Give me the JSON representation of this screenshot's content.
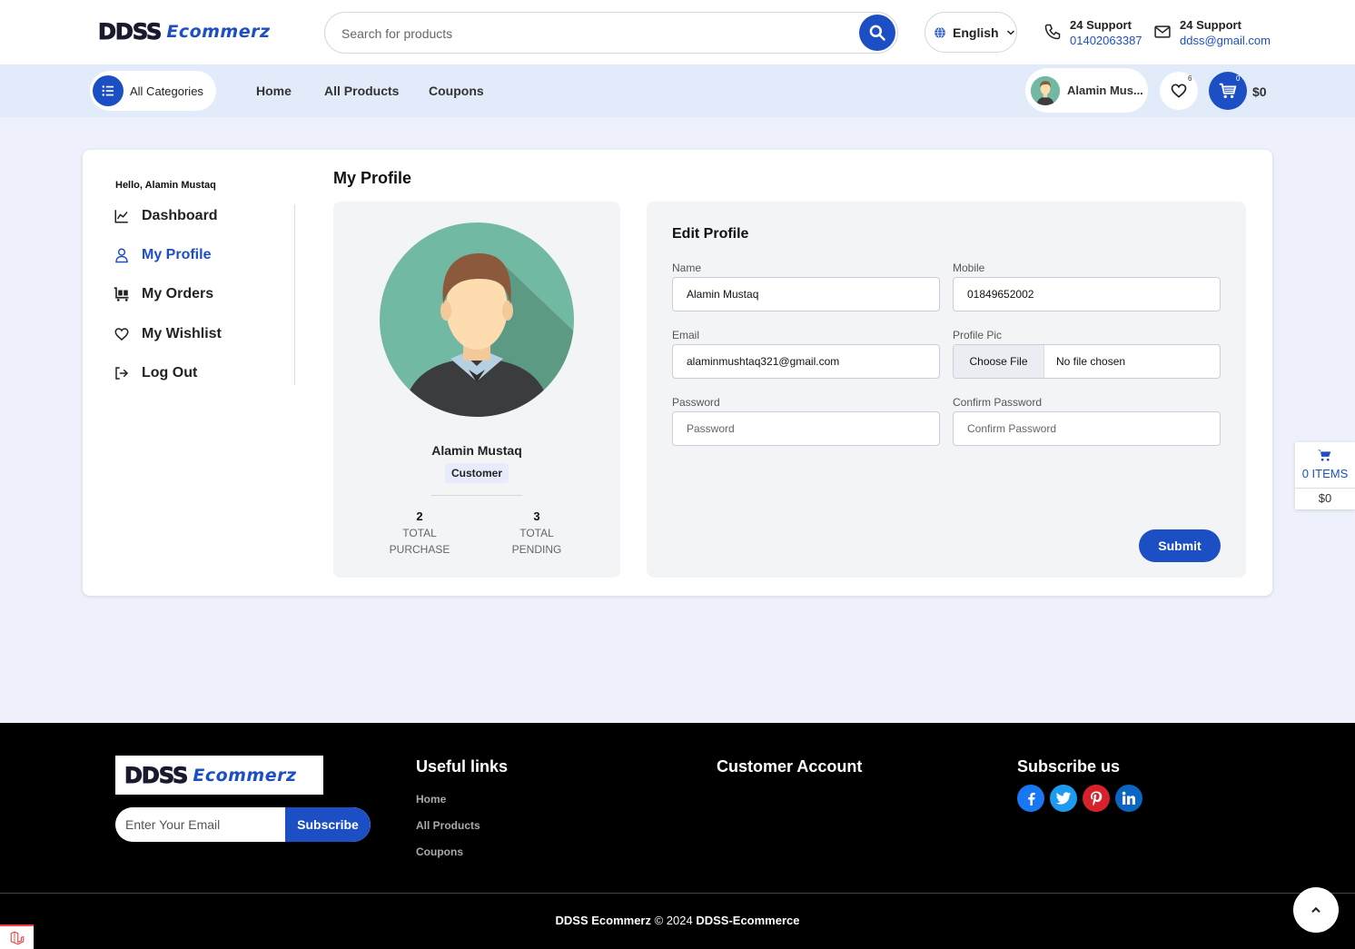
{
  "header": {
    "logo": {
      "part1": "DDSS",
      "part2": "Ecommerz"
    },
    "search": {
      "placeholder": "Search for products"
    },
    "language": "English",
    "phone_support": {
      "title": "24 Support",
      "value": "01402063387"
    },
    "email_support": {
      "title": "24 Support",
      "value": "ddss@gmail.com"
    }
  },
  "nav": {
    "all_categories": "All Categories",
    "links": [
      "Home",
      "All Products",
      "Coupons"
    ],
    "user_name": "Alamin Mus...",
    "wishlist_count": "6",
    "cart_count": "0",
    "cart_total": "$0"
  },
  "sidebar": {
    "greeting": "Hello, Alamin Mustaq",
    "items": [
      "Dashboard",
      "My Profile",
      "My Orders",
      "My Wishlist",
      "Log Out"
    ]
  },
  "profile": {
    "page_title": "My Profile",
    "name": "Alamin Mustaq",
    "role": "Customer",
    "stats": [
      {
        "value": "2",
        "label1": "TOTAL",
        "label2": "PURCHASE"
      },
      {
        "value": "3",
        "label1": "TOTAL",
        "label2": "PENDING"
      }
    ]
  },
  "edit_profile": {
    "title": "Edit Profile",
    "name_label": "Name",
    "name_value": "Alamin Mustaq",
    "mobile_label": "Mobile",
    "mobile_value": "01849652002",
    "email_label": "Email",
    "email_value": "alaminmushtaq321@gmail.com",
    "pic_label": "Profile Pic",
    "file_button": "Choose File",
    "file_status": "No file chosen",
    "password_label": "Password",
    "password_placeholder": "Password",
    "confirm_label": "Confirm Password",
    "confirm_placeholder": "Confirm Password",
    "submit": "Submit"
  },
  "floating_cart": {
    "items": "0 ITEMS",
    "total": "$0"
  },
  "footer": {
    "logo": {
      "part1": "DDSS",
      "part2": "Ecommerz"
    },
    "email_placeholder": "Enter Your Email",
    "subscribe": "Subscribe",
    "useful_links_title": "Useful links",
    "useful_links": [
      "Home",
      "All Products",
      "Coupons"
    ],
    "customer_account_title": "Customer Account",
    "subscribe_title": "Subscribe us",
    "copyright_brand": "DDSS Ecommerz",
    "copyright_mid": " © 2024 ",
    "copyright_company": "DDSS-Ecommerce"
  },
  "colors": {
    "accent": "#1d4fc4",
    "nav_bg": "#e2ebf9",
    "page_bg": "#eef1fb"
  },
  "icons": {
    "search": "search-icon",
    "globe": "globe-icon",
    "phone": "phone-icon",
    "mail": "mail-icon",
    "list": "list-icon",
    "heart": "heart-icon",
    "cart": "cart-icon",
    "chart": "chart-icon",
    "user": "user-icon",
    "orders": "cart-flatbed-icon",
    "logout": "logout-icon",
    "arrow_up": "arrow-up-icon"
  }
}
